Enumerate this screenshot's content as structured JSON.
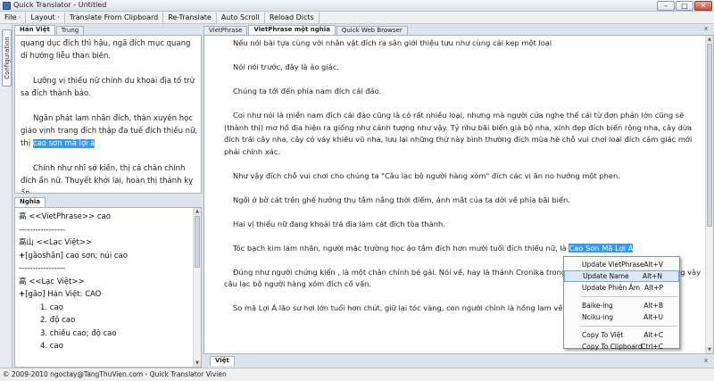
{
  "window": {
    "title": "Quick Translator - Untitled",
    "minimize": "–",
    "maximize": "□",
    "close": "✕"
  },
  "menu": [
    "File ·",
    "Layout ·",
    "Translate From Clipboard",
    "Re-Translate",
    "Auto Scroll",
    "Reload Dicts"
  ],
  "side_tab": "Configuration",
  "source_tabs": [
    "Hán Việt",
    "Trung"
  ],
  "source_paragraphs": [
    "quang dục đích thì hậu, ngã đích mục quang di hướng liễu than biên.",
    "Lưỡng vị thiếu nữ chính du khoái địa tố trứ sa đích thành bảo.",
    "Ngãn phát lam nhãn đích, thân xuyên học giáo vịnh trang đích thập đa tuế đích thiếu nữ, thị ",
    "Chính như nhĩ sở kiến, thị cá chân chính đích ẩn nữ. Thuyết khởi lai, hoàn thị thánh kỵ ẩn"
  ],
  "source_highlight": "cao sơn mã lợi á",
  "meaning_tab": "Nghĩa",
  "meaning_lines": [
    "高 <<VietPhrase>> cao",
    "-----------------",
    "高山 <<Lạc Việt>>",
    "[gāoshān] cao sơn; núi cao",
    "-----------------",
    "高 <<Lạc Việt>>",
    "[gāo] Hán Việt: CAO",
    "1. cao",
    "2. độ cao",
    "3. chiều cao; độ cao",
    "4. cao"
  ],
  "main_tabs": [
    "VietPhrase",
    "VietPhrase một nghĩa",
    "Quick Web Browser"
  ],
  "main_tab_close": "x",
  "main_paragraphs": [
    "Nếu nói bài tựa cùng với nhân vật đích ra sân giới thiệu tựu như cùng cái kẹp một loại",
    "Nói nói trước, đây là ảo giác.",
    "Chúng ta tới đến phía nam đích cái đảo.",
    "Coi như nói là miền nam đích cái đảo cũng là có rất nhiều loại, nhưng mà người cửa nghe thế cái từ đơn phản lớn cũng sẽ (thành thị) mơ hồ địa hiện ra giống như cảnh tượng như vậy. Tỷ như bãi biển giả bộ nha, xinh đẹp đích biển rộng nha, cây dừa đích trái cây nha, cây cỏ váy khiêu vũ nha, lưu lại những thứ này bình thường đích mùa hè chỗ vui chơi loại đích cảm giác mới phải chính xác.",
    "Như vậy đích chỗ vui chơi cho chúng ta \"Câu lạc bộ người hàng xóm\" đích các vị ăn no hưởng một phen.",
    "Ngồi ở bờ cát trên ghế hưởng thụ tắm nắng thời điểm, ánh mắt của ta dời về phía bãi biển.",
    "Hai vị thiếu nữ đang khoái trá địa làm cát đích tòa thành.",
    "Tóc bạch kim lam nhãn, người mặc trường học áo tắm đích hơn mười tuổi đích thiếu nữ, là ",
    "Đúng như người chứng kiến , là một chân chính bé gái. Nói về, hay là thánh Cronika trong học viện tối cao đồng thời cùng vậy câu lạc bộ người hàng xóm đích cố vấn.",
    "So mã Lợi Á lão sư hơi lớn tuổi hơn chút, giữ lại tóc vàng, con người chính là hồng lam về kia, Hasegawa Kobato."
  ],
  "main_highlight": "Cao Sơn Mã Lợi Á",
  "bottom_tab": "Việt",
  "context_menu": [
    {
      "label": "Update VietPhrase",
      "shortcut": "Alt+V"
    },
    {
      "label": "Update Name",
      "shortcut": "Alt+N"
    },
    {
      "label": "Update Phiên Âm",
      "shortcut": "Alt+P"
    },
    {
      "label": "Baike-ing",
      "shortcut": "Alt+B"
    },
    {
      "label": "Nciku-ing",
      "shortcut": "Alt+U"
    },
    {
      "label": "Copy To Việt",
      "shortcut": "Alt+C"
    },
    {
      "label": "Copy To Clipboard",
      "shortcut": "Ctrl+C"
    }
  ],
  "status": "© 2009-2010 ngoctay@TangThuVien.com - Quick Translator Vivien",
  "colors": {
    "highlight": "#3399ff",
    "menu_hover": "#dbe8f8"
  }
}
